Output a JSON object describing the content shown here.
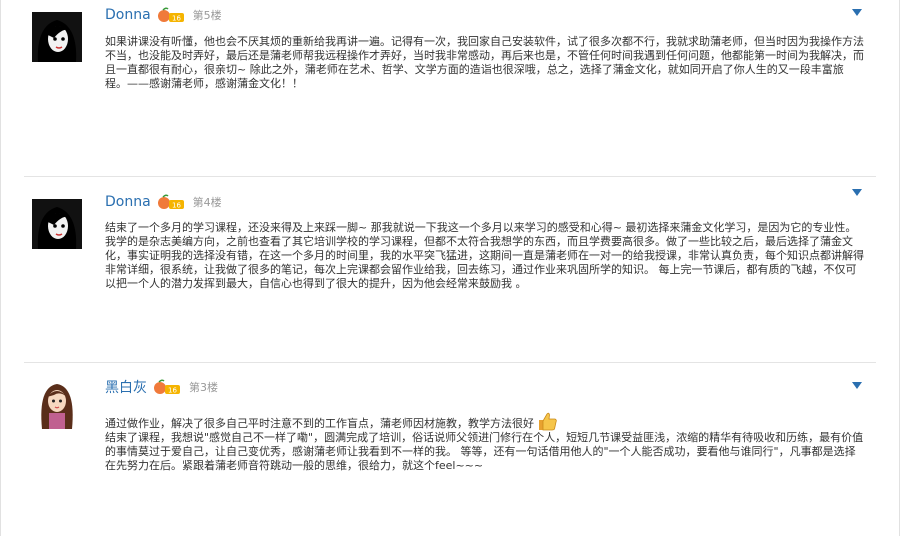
{
  "posts": [
    {
      "username": "Donna",
      "floor": "第5楼",
      "level_icon": "peach-level-icon",
      "paragraphs": [
        "如果讲课没有听懂，他也会不厌其烦的重新给我再讲一遍。记得有一次，我回家自己安装软件，试了很多次都不行，我就求助蒲老师，但当时因为我操作方法不当，也没能及时弄好，最后还是蒲老师帮我远程操作才弄好，当时我非常感动，再后来也是，不管任何时间我遇到任何问题，他都能第一时间为我解决，而且一直都很有耐心，很亲切~ 除此之外，蒲老师在艺术、哲学、文学方面的造诣也很深哦，总之，选择了蒲金文化，就如同开启了你人生的又一段丰富旅程。——感谢蒲老师，感谢蒲金文化！！"
      ]
    },
    {
      "username": "Donna",
      "floor": "第4楼",
      "level_icon": "peach-level-icon",
      "paragraphs": [
        "结束了一个多月的学习课程，还没来得及上来踩一脚~ 那我就说一下我这一个多月以来学习的感受和心得~ 最初选择来蒲金文化学习，是因为它的专业性。我学的是杂志美编方向，之前也查看了其它培训学校的学习课程，但都不太符合我想学的东西，而且学费要高很多。做了一些比较之后，最后选择了蒲金文化，事实证明我的选择没有错，在这一个多月的时间里，我的水平突飞猛进，这期间一直是蒲老师在一对一的给我授课，非常认真负责，每个知识点都讲解得非常详细，很系统，让我做了很多的笔记，每次上完课都会留作业给我，回去练习，通过作业来巩固所学的知识。 每上完一节课后，都有质的飞越，不仅可以把一个人的潜力发挥到最大，自信心也得到了很大的提升，因为他会经常来鼓励我 。"
      ]
    },
    {
      "username": "黑白灰",
      "floor": "第3楼",
      "level_icon": "peach-level-icon",
      "paragraphs": [
        "通过做作业，解决了很多自己平时注意不到的工作盲点，蒲老师因材施教，教学方法很好",
        "结束了课程，我想说\"感觉自己不一样了嘞\"，圆满完成了培训，俗话说师父领进门修行在个人，短短几节课受益匪浅，浓缩的精华有待吸收和历练，最有价值的事情莫过于爱自己，让自己变优秀，感谢蒲老师让我看到不一样的我。 等等，还有一句话借用他人的\"一个人能否成功，要看他与谁同行\"，凡事都是选择在先努力在后。紧跟着蒲老师音符跳动一般的思维，很给力，就这个feel~~~"
      ]
    }
  ],
  "colors": {
    "username": "#2a6fb0",
    "floor": "#999999",
    "divider": "#e4e4e4"
  }
}
